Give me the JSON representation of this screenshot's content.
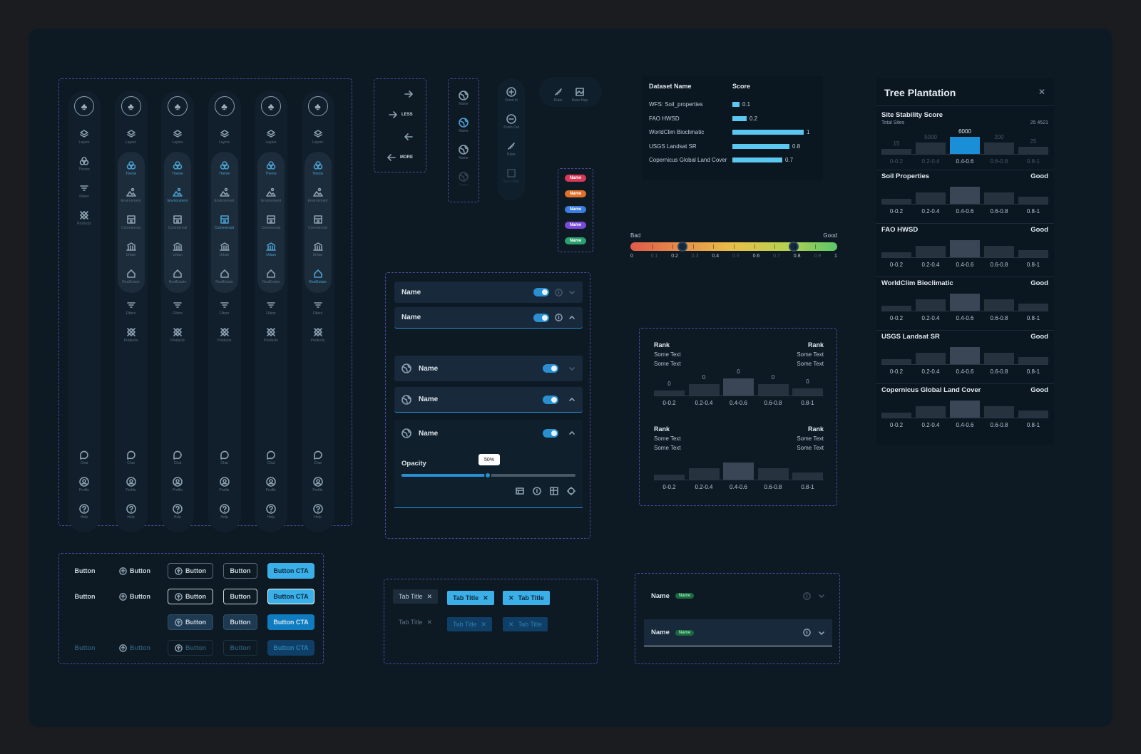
{
  "sidebar": {
    "layers": "Layers",
    "theme": "Theme",
    "filters": "Filters",
    "products": "Products",
    "environment": "Environment",
    "commercial": "Commercial",
    "urban": "Urban",
    "realestate": "RealEstate",
    "chat": "Chat",
    "profile": "Profile",
    "help": "Help"
  },
  "nav": {
    "less": "LESS",
    "more": "MORE"
  },
  "tools": {
    "name": "Name",
    "zoom_in": "Zoom In",
    "zoom_out": "Zoom Out",
    "ruler": "Ruler",
    "base_map": "Base Map"
  },
  "chips": [
    "Name",
    "Name",
    "Name",
    "Name",
    "Name"
  ],
  "chip_colors": [
    "#d93a5a",
    "#e0702a",
    "#3a7ce0",
    "#7a4ad8",
    "#2aa070"
  ],
  "table": {
    "col1": "Dataset Name",
    "col2": "Score",
    "rows": [
      {
        "name": "WFS: Soil_properties",
        "score": "0.1"
      },
      {
        "name": "FAO HWSD",
        "score": "0.2"
      },
      {
        "name": "WorldClim Bioclimatic",
        "score": "1"
      },
      {
        "name": "USGS Landsat SR",
        "score": "0.8"
      },
      {
        "name": "Copernicus Global Land Cover",
        "score": "0.7"
      }
    ]
  },
  "scale": {
    "bad": "Bad",
    "good": "Good",
    "ticks": [
      "0",
      "0.1",
      "0.2",
      "0.3",
      "0.4",
      "0.5",
      "0.6",
      "0.7",
      "0.8",
      "0.9",
      "1"
    ]
  },
  "layer_rows": {
    "name": "Name",
    "opacity": "Opacity",
    "opacity_value": "50%"
  },
  "rank": {
    "title": "Rank",
    "text": "Some Text",
    "bins": [
      "0-0.2",
      "0.2-0.4",
      "0.4-0.6",
      "0.6-0.8",
      "0.8-1"
    ],
    "counts": [
      "0",
      "0",
      "0",
      "0",
      "0"
    ]
  },
  "buttons": {
    "button": "Button",
    "cta": "Button CTA"
  },
  "tabs": {
    "title": "Tab Title"
  },
  "accordion": {
    "name": "Name",
    "badge": "Name"
  },
  "tree": {
    "title": "Tree Plantation",
    "stability": "Site Stability Score",
    "total_sites": "Total Sites",
    "total_value": "25 4521",
    "top_counts": [
      "15",
      "5000",
      "6000",
      "200",
      "25"
    ],
    "bins": [
      "0-0.2",
      "0.2-0.4",
      "0.4-0.6",
      "0.6-0.8",
      "0.8-1"
    ],
    "sections": [
      "Soil Properties",
      "FAO HWSD",
      "WorldClim Bioclimatic",
      "USGS Landsat SR",
      "Copernicus Global Land Cover"
    ],
    "good": "Good"
  }
}
